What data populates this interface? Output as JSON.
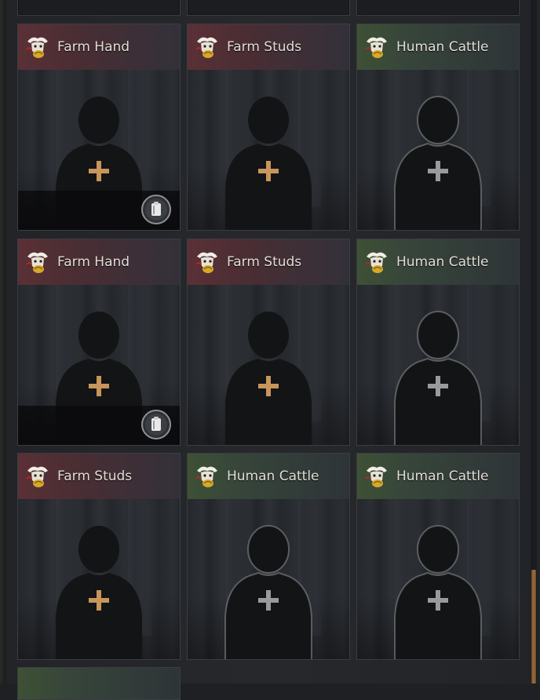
{
  "colors": {
    "red_header": "#5a3036",
    "green_header": "#3e5035",
    "plus_active": "#c8955a",
    "plus_inactive": "#9a9a9a",
    "scrollbar": "#9c6e3c"
  },
  "icons": {
    "trait": "trait-badge-icon",
    "plus": "add-plus-icon",
    "coin": "milk-bucket-coin-icon"
  },
  "cards": [
    {
      "title": "Farm Hand",
      "theme": "red",
      "plus": "active",
      "coin": true
    },
    {
      "title": "Farm Studs",
      "theme": "red",
      "plus": "active",
      "coin": false
    },
    {
      "title": "Human Cattle",
      "theme": "green",
      "plus": "inactive",
      "coin": false
    },
    {
      "title": "Farm Hand",
      "theme": "red",
      "plus": "active",
      "coin": true
    },
    {
      "title": "Farm Studs",
      "theme": "red",
      "plus": "active",
      "coin": false
    },
    {
      "title": "Human Cattle",
      "theme": "green",
      "plus": "inactive",
      "coin": false
    },
    {
      "title": "Farm Studs",
      "theme": "red",
      "plus": "active",
      "coin": false
    },
    {
      "title": "Human Cattle",
      "theme": "green",
      "plus": "inactive",
      "coin": false
    },
    {
      "title": "Human Cattle",
      "theme": "green",
      "plus": "inactive",
      "coin": false
    }
  ]
}
